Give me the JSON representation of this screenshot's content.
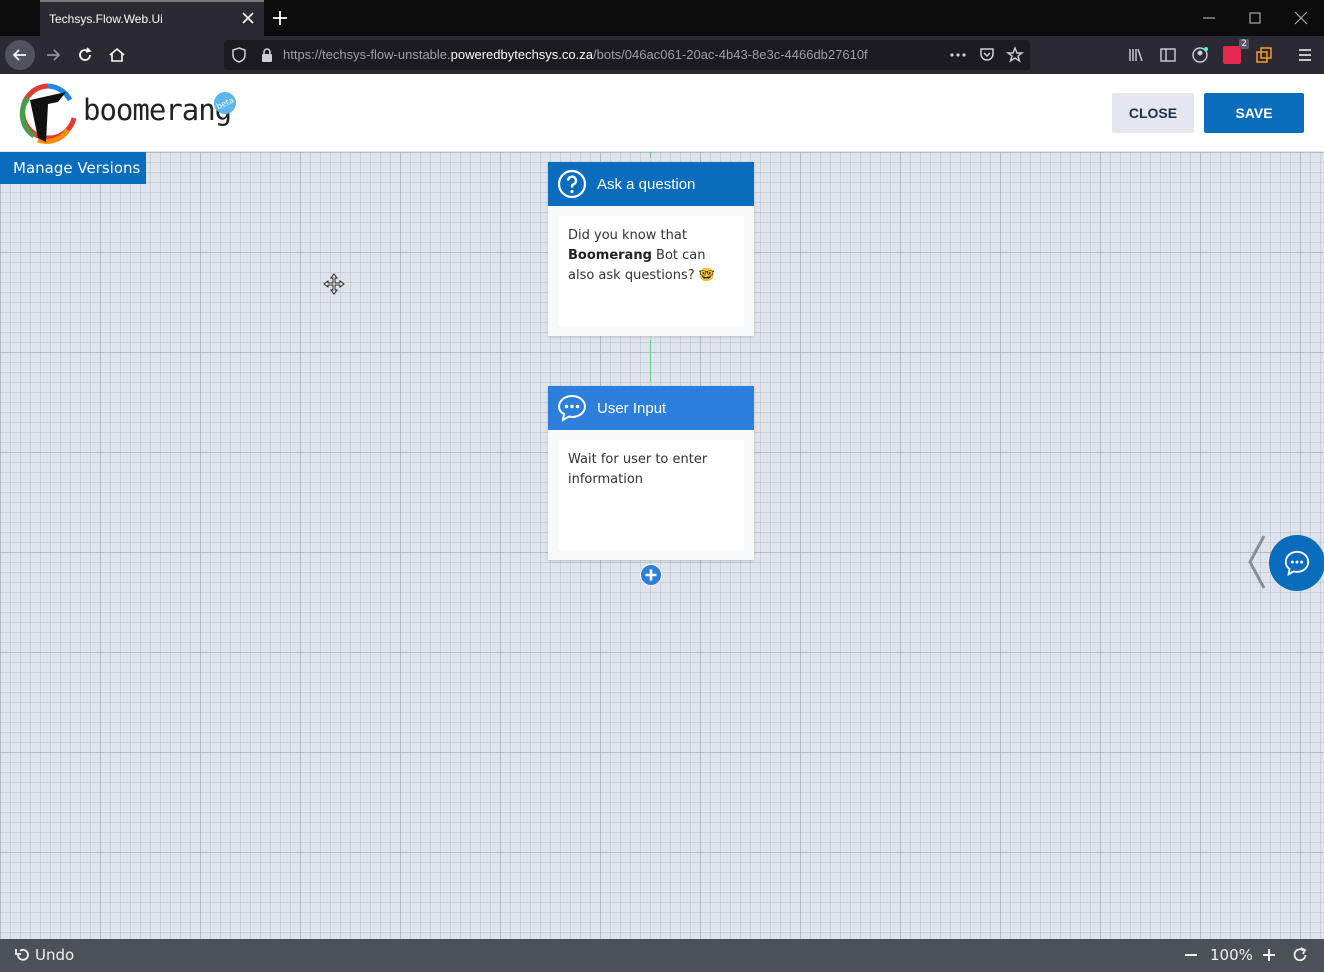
{
  "browser": {
    "tab_title": "Techsys.Flow.Web.Ui",
    "url_prefix": "https://techsys-flow-unstable.",
    "url_host": "poweredbytechsys.co.za",
    "url_path": "/bots/046ac061-20ac-4b43-8e3c-4466db27610f",
    "extension_badge": "2"
  },
  "header": {
    "logo_text": "boomerang",
    "beta_label": "beta",
    "close_label": "CLOSE",
    "save_label": "SAVE"
  },
  "canvas": {
    "manage_versions_label": "Manage Versions",
    "nodes": [
      {
        "type": "question",
        "title": "Ask a question",
        "body_pre": "Did you know that ",
        "body_bold": "Boomerang",
        "body_post": " Bot can also ask questions? 🤓",
        "header_color": "#0a6cbd"
      },
      {
        "type": "user-input",
        "title": "User Input",
        "body": "Wait for user to enter information",
        "header_color": "#2d7fdc"
      }
    ]
  },
  "footer": {
    "undo_label": "Undo",
    "zoom_level": "100%"
  },
  "colors": {
    "primary": "#0a6cbd",
    "connector": "#6cc48f",
    "footer_bg": "#4c5158"
  }
}
